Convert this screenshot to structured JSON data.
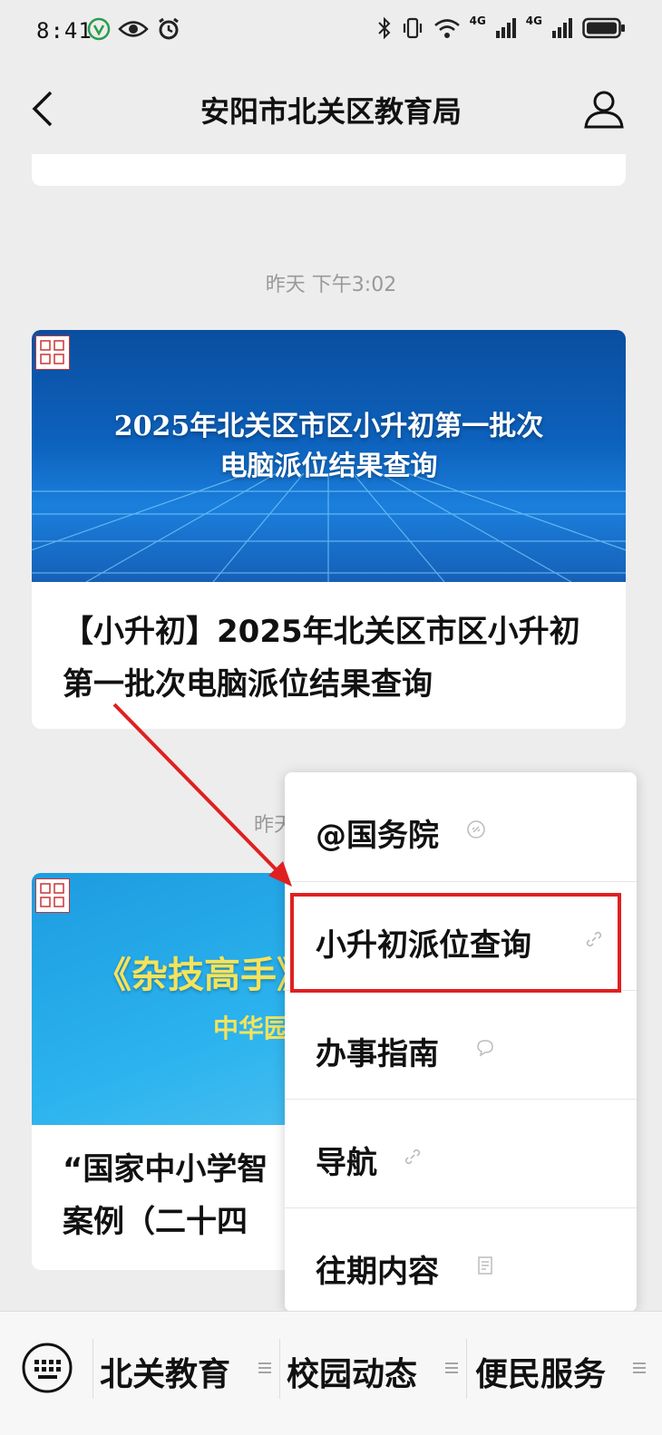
{
  "status_bar": {
    "time": "8:41",
    "network_labels": [
      "4G",
      "4G"
    ]
  },
  "header": {
    "title": "安阳市北关区教育局"
  },
  "feed": {
    "timestamp1": "昨天 下午3:02",
    "article1": {
      "banner_text_line1": "2025年北关区市区小升初第一批次",
      "banner_text_line2": "电脑派位结果查询",
      "headline": "【小升初】2025年北关区市区小升初第一批次电脑派位结果查询"
    },
    "timestamp2_partial": "昨天",
    "article2": {
      "banner_text": "《杂技高手》",
      "banner_subtext": "中华园",
      "headline_line1": "“国家中小学智",
      "headline_line2": "案例（二十四"
    }
  },
  "menu": {
    "items": [
      {
        "label": "@国务院",
        "icon": "link-icon"
      },
      {
        "label": "小升初派位查询",
        "icon": "link-icon"
      },
      {
        "label": "办事指南",
        "icon": "chat-bubble-icon"
      },
      {
        "label": "导航",
        "icon": "link-icon"
      },
      {
        "label": "往期内容",
        "icon": "document-icon"
      }
    ]
  },
  "bottom_menu": {
    "tabs": [
      {
        "label": "北关教育"
      },
      {
        "label": "校园动态"
      },
      {
        "label": "便民服务"
      }
    ]
  },
  "colors": {
    "highlight": "#e02020",
    "background": "#ededed"
  }
}
